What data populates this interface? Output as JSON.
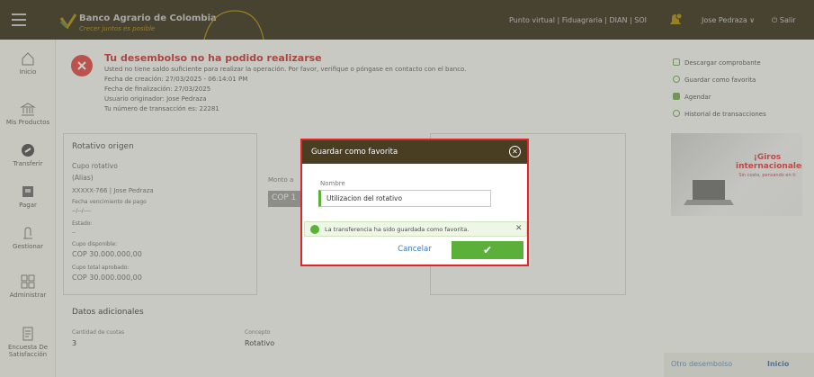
{
  "app": {
    "bank_name": "Banco Agrario de Colombia",
    "slogan": "Crecer juntos es posible"
  },
  "header": {
    "links": "Punto virtual | Fiduagraria | DIAN | SOI",
    "notification_count": "0",
    "user": "Jose Pedraza ∨",
    "logout": "Salir"
  },
  "sidebar": {
    "items": [
      {
        "label": "Inicio",
        "icon": "home-icon"
      },
      {
        "label": "Mis Productos",
        "icon": "bank-icon"
      },
      {
        "label": "Transferir",
        "icon": "transfer-icon"
      },
      {
        "label": "Pagar",
        "icon": "payment-icon"
      },
      {
        "label": "Gestionar",
        "icon": "manage-icon"
      },
      {
        "label": "Administrar",
        "icon": "grid-icon"
      },
      {
        "label": "Encuesta De Satisfacción",
        "icon": "survey-icon"
      }
    ]
  },
  "error": {
    "title": "Tu desembolso no ha podido realizarse",
    "message": "Usted no tiene saldo suficiente para realizar la operación. Por favor, verifique o póngase en contacto con el banco.",
    "created": "Fecha de creación: 27/03/2025 - 06:14:01 PM",
    "finished": "Fecha de finalización: 27/03/2025",
    "user": "Usuario originador: Jose Pedraza",
    "transaction": "Tu número de transacción es: 22281"
  },
  "actions": [
    {
      "label": "Descargar comprobante",
      "icon": "download-icon"
    },
    {
      "label": "Guardar como favorita",
      "icon": "heart-icon"
    },
    {
      "label": "Agendar",
      "icon": "calendar-icon"
    },
    {
      "label": "Historial de transacciones",
      "icon": "history-icon"
    }
  ],
  "origin": {
    "title": "Rotativo origen",
    "product": "Cupo rotativo",
    "alias": "(Alias)",
    "account": "XXXXX-766 | Jose Pedraza",
    "due_label": "Fecha vencimiento de pago",
    "due_value": "--/--/----",
    "state_label": "Estado:",
    "state_value": "--",
    "available_label": "Cupo disponible:",
    "available_value": "COP 30.000.000,00",
    "approved_label": "Cupo total aprobado:",
    "approved_value": "COP 30.000.000,00"
  },
  "amount": {
    "label": "Monto a",
    "currency": "COP 1"
  },
  "promo": {
    "headline": "¡Giros internacionales!",
    "sub": "Sin costo, pensando en ti"
  },
  "extra": {
    "title": "Datos adicionales",
    "cuotas_label": "Cantidad de cuotas",
    "cuotas_value": "3",
    "concepto_label": "Concepto",
    "concepto_value": "Rotativo"
  },
  "footer": {
    "other": "Otro desembolso",
    "home": "Inicio"
  },
  "modal": {
    "title": "Guardar como favorita",
    "name_label": "Nombre",
    "name_value": "Utilizacion del rotativo",
    "toast": "La transferencia ha sido guardada como favorita.",
    "cancel": "Cancelar",
    "confirm_icon": "check-icon"
  },
  "colors": {
    "header_bg": "#45391e",
    "accent_green": "#5bb03a",
    "error_red": "#e23b3b",
    "highlight_red": "#e0262b"
  }
}
